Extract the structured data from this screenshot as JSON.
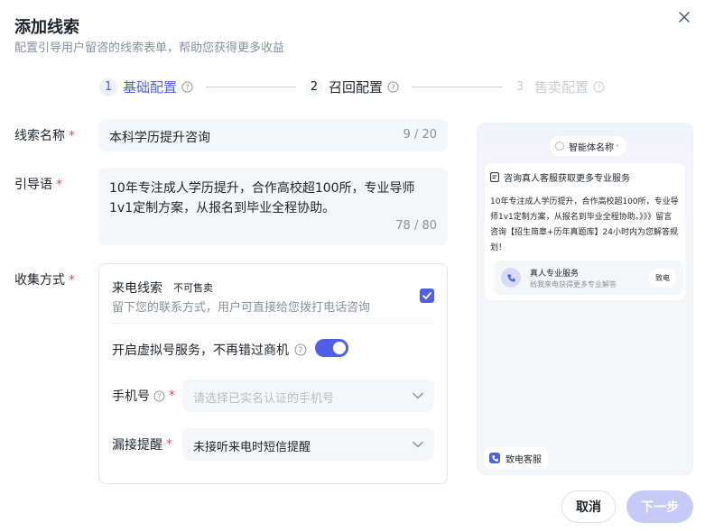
{
  "header": {
    "title": "添加线索",
    "subtitle": "配置引导用户留咨的线索表单，帮助您获得更多收益"
  },
  "steps": [
    {
      "num": "1",
      "label": "基础配置",
      "state": "active"
    },
    {
      "num": "2",
      "label": "召回配置",
      "state": "normal"
    },
    {
      "num": "3",
      "label": "售卖配置",
      "state": "disabled"
    }
  ],
  "form": {
    "name_label": "线索名称",
    "name_value": "本科学历提升咨询",
    "name_count": "9 / 20",
    "guide_label": "引导语",
    "guide_value": "10年专注成人学历提升，合作高校超100所，专业导师1v1定制方案，从报名到毕业全程协助。",
    "guide_count": "78 / 80",
    "collect_label": "收集方式",
    "collect": {
      "option_title": "来电线索",
      "option_tag": "不可售卖",
      "option_desc": "留下您的联系方式，用户可直接给您拨打电话咨询",
      "option_checked": true,
      "virtual_label": "开启虚拟号服务，不再错过商机",
      "virtual_on": true,
      "phone_label": "手机号",
      "phone_placeholder": "请选择已实名认证的手机号",
      "missed_label": "漏接提醒",
      "missed_value": "未接听来电时短信提醒"
    }
  },
  "preview": {
    "agent_name": "智能体名称",
    "card_title": "咨询真人客服获取更多专业服务",
    "card_body": "10年专注成人学历提升，合作高校超100所，专业导师1v1定制方案，从报名到毕业全程协助。》》》留言咨询【招生简章+历年真题库】24小时内为您解答规划！",
    "service_title": "真人专业服务",
    "service_desc": "给我来电获得更多专业解答",
    "service_button": "致电",
    "call_chip": "致电客服"
  },
  "footer": {
    "cancel": "取消",
    "next": "下一步"
  },
  "colors": {
    "accent": "#4f5fe8",
    "required": "#e34d59",
    "next_disabled": "#c5cbf6"
  }
}
